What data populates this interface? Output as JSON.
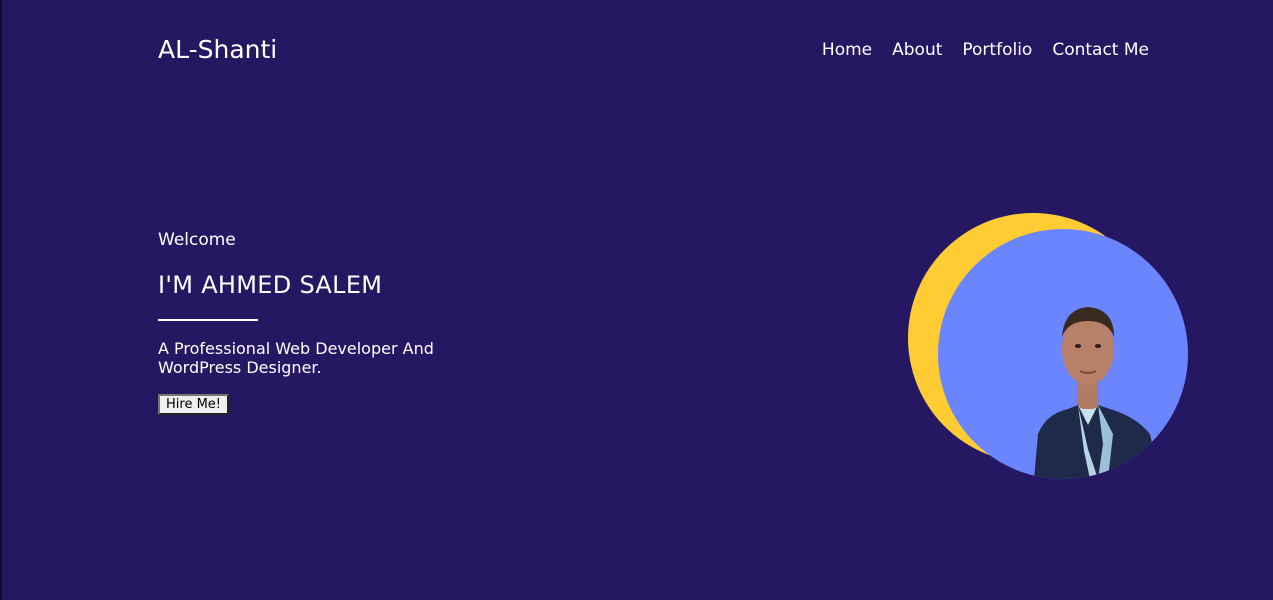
{
  "header": {
    "logo": "AL-Shanti",
    "nav": [
      {
        "label": "Home"
      },
      {
        "label": "About"
      },
      {
        "label": "Portfolio"
      },
      {
        "label": "Contact Me"
      }
    ]
  },
  "hero": {
    "welcome": "Welcome",
    "headline": "I'M AHMED SALEM",
    "subtitle": "A Professional Web Developer And WordPress Designer.",
    "hire_button": "Hire Me!"
  },
  "colors": {
    "background": "#261762",
    "accent_yellow": "#ffcd33",
    "accent_blue": "#6b85ff"
  },
  "icons": {
    "portrait": "person-photo"
  }
}
